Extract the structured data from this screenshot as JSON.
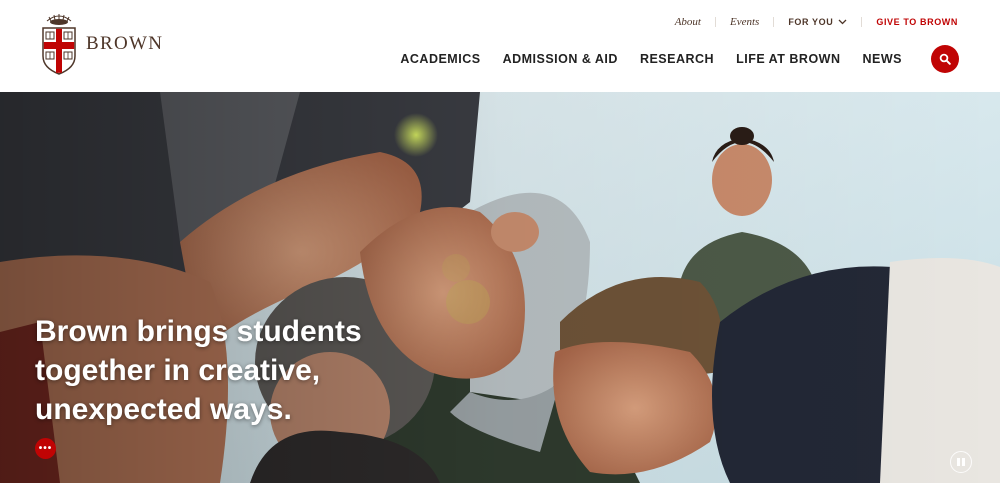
{
  "brand": {
    "wordmark": "BROWN"
  },
  "utility_nav": {
    "about": "About",
    "events": "Events",
    "for_you": "FOR YOU",
    "give": "GIVE TO BROWN"
  },
  "main_nav": {
    "items": [
      "ACADEMICS",
      "ADMISSION & AID",
      "RESEARCH",
      "LIFE AT BROWN",
      "NEWS"
    ]
  },
  "search": {
    "icon": "search-icon"
  },
  "hero": {
    "headline_lines": [
      "Brown brings students",
      "together in creative,",
      "unexpected ways."
    ],
    "more_label": "•••",
    "pause_icon": "pause-icon"
  },
  "colors": {
    "brand_red": "#c00404",
    "brand_brown": "#4e3629",
    "nav_text": "#222222"
  }
}
